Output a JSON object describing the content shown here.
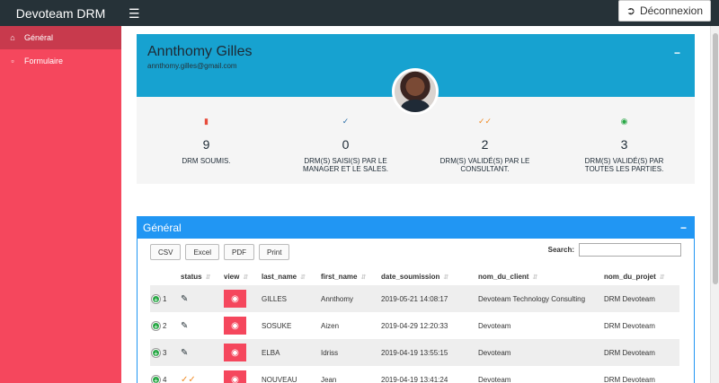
{
  "app": {
    "title": "Devoteam DRM",
    "logout_label": "Déconnexion"
  },
  "sidebar": {
    "items": [
      {
        "label": "Général",
        "icon": "home-icon"
      },
      {
        "label": "Formulaire",
        "icon": "file-icon"
      }
    ]
  },
  "profile": {
    "name": "Annthomy Gilles",
    "email": "annthomy.gilles@gmail.com",
    "stats": [
      {
        "value": "9",
        "label": "DRM SOUMIS.",
        "icon": "file-icon",
        "color": "#e74c3c"
      },
      {
        "value": "0",
        "label": "DRM(S) SAISI(S) PAR LE MANAGER ET LE SALES.",
        "icon": "check-icon",
        "color": "#2a6ea8"
      },
      {
        "value": "2",
        "label": "DRM(S) VALIDÉ(S) PAR LE CONSULTANT.",
        "icon": "double-check-icon",
        "color": "#f08a24"
      },
      {
        "value": "3",
        "label": "DRM(S) VALIDÉ(S) PAR TOUTES LES PARTIES.",
        "icon": "check-circle-icon",
        "color": "#28a745"
      }
    ]
  },
  "panel": {
    "title": "Général",
    "buttons": [
      "CSV",
      "Excel",
      "PDF",
      "Print"
    ],
    "search_label": "Search:",
    "columns": [
      "",
      "status",
      "view",
      "last_name",
      "first_name",
      "date_soumission",
      "nom_du_client",
      "nom_du_projet"
    ],
    "rows": [
      {
        "index": "1",
        "status": "edit",
        "last_name": "GILLES",
        "first_name": "Annthomy",
        "date": "2019-05-21 14:08:17",
        "client": "Devoteam Technology Consulting",
        "project": "DRM Devoteam"
      },
      {
        "index": "2",
        "status": "edit",
        "last_name": "SOSUKE",
        "first_name": "Aizen",
        "date": "2019-04-29 12:20:33",
        "client": "Devoteam",
        "project": "DRM Devoteam"
      },
      {
        "index": "3",
        "status": "edit",
        "last_name": "ELBA",
        "first_name": "Idriss",
        "date": "2019-04-19 13:55:15",
        "client": "Devoteam",
        "project": "DRM Devoteam"
      },
      {
        "index": "4",
        "status": "validated",
        "last_name": "NOUVEAU",
        "first_name": "Jean",
        "date": "2019-04-19 13:41:24",
        "client": "Devoteam",
        "project": "DRM Devoteam"
      }
    ]
  }
}
